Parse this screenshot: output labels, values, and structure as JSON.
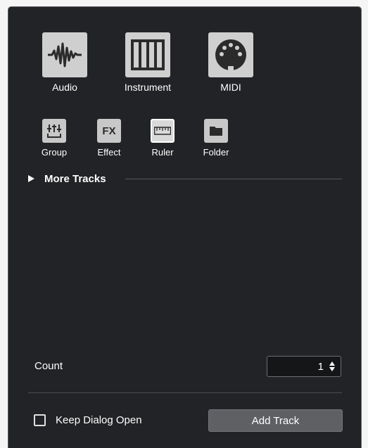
{
  "main_tracks": [
    {
      "label": "Audio",
      "icon": "audio-waveform-icon"
    },
    {
      "label": "Instrument",
      "icon": "piano-keys-icon"
    },
    {
      "label": "MIDI",
      "icon": "midi-connector-icon"
    }
  ],
  "other_tracks": [
    {
      "label": "Group",
      "icon": "group-fader-icon",
      "selected": false
    },
    {
      "label": "Effect",
      "icon": "fx-icon",
      "icon_text": "FX",
      "selected": false
    },
    {
      "label": "Ruler",
      "icon": "ruler-icon",
      "selected": true
    },
    {
      "label": "Folder",
      "icon": "folder-icon",
      "selected": false
    }
  ],
  "more_tracks": {
    "label": "More Tracks",
    "expanded": false
  },
  "count": {
    "label": "Count",
    "value": "1"
  },
  "footer": {
    "keep_open": {
      "label": "Keep Dialog Open",
      "checked": false
    },
    "add_button": "Add Track"
  },
  "colors": {
    "background": "#222326",
    "button_face": "#cfcfcf",
    "add_button": "#5e6064"
  }
}
